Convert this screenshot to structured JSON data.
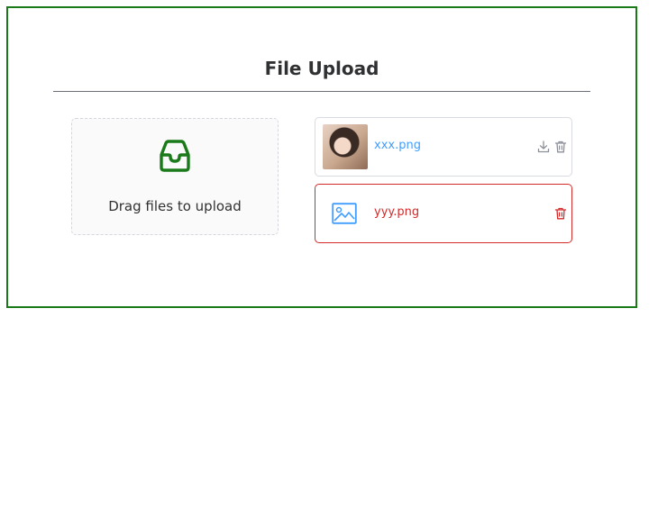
{
  "header": {
    "title": "File Upload"
  },
  "dropzone": {
    "hint": "Drag files to upload",
    "icon": "inbox-icon"
  },
  "files": [
    {
      "name": "xxx.png",
      "status": "success",
      "preview": "thumbnail-image",
      "actions": [
        "download-icon",
        "trash-icon"
      ]
    },
    {
      "name": "yyy.png",
      "status": "error",
      "preview": "image-placeholder-icon",
      "actions": [
        "trash-icon"
      ]
    }
  ],
  "colors": {
    "frame_border": "#1a7a1a",
    "link_blue": "#409eff",
    "error_red": "#d42a2a",
    "icon_grey": "#8c8f97"
  }
}
